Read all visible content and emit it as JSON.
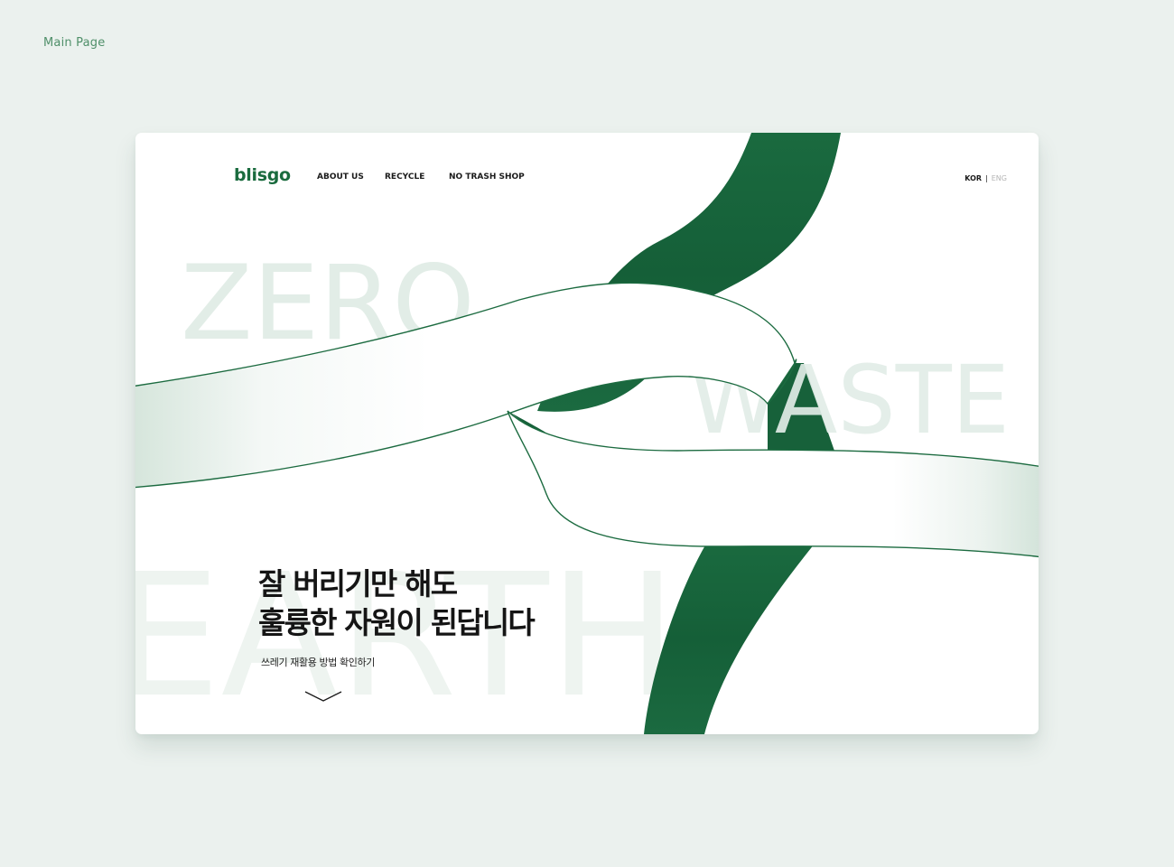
{
  "caption": "Main Page",
  "header": {
    "logo": "blisgo",
    "nav": [
      {
        "label": "ABOUT US"
      },
      {
        "label": "RECYCLE"
      },
      {
        "label": "NO TRASH SHOP"
      }
    ],
    "lang": {
      "active": "KOR",
      "separator": "|",
      "inactive": "ENG"
    }
  },
  "hero": {
    "bg_words": [
      "ZERO",
      "WASTE",
      "EARTH"
    ],
    "headline_line1": "잘 버리기만 해도",
    "headline_line2": "훌륭한 자원이 된답니다",
    "cta": "쓰레기 재활용 방법 확인하기"
  },
  "colors": {
    "page_bg": "#ebf1ee",
    "brand_green": "#1a6b3e",
    "ribbon_dark": "#17613a",
    "watermark": "#e2ede7"
  },
  "icons": {
    "scroll": "chevron-down-icon"
  }
}
